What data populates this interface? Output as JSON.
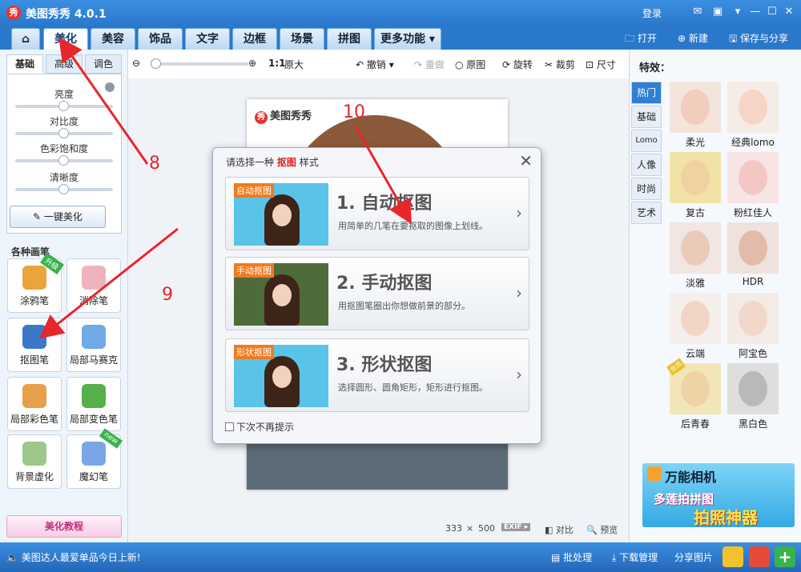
{
  "app": {
    "title": "美图秀秀 4.0.1",
    "logo_char": "秀",
    "login": "登录"
  },
  "menu": {
    "tabs": [
      "美化",
      "美容",
      "饰品",
      "文字",
      "边框",
      "场景",
      "拼图",
      "更多功能"
    ],
    "active": "美化",
    "right": {
      "open": "打开",
      "new": "新建",
      "save_share": "保存与分享"
    }
  },
  "left": {
    "subtabs": [
      "基础",
      "高级",
      "调色"
    ],
    "sliders": [
      "亮度",
      "对比度",
      "色彩饱和度",
      "清晰度"
    ],
    "one_key": "一键美化",
    "brush_title": "各种画笔",
    "tools": [
      {
        "label": "涂鸦笔",
        "badge": "升级"
      },
      {
        "label": "消除笔",
        "badge": ""
      },
      {
        "label": "抠图笔",
        "badge": ""
      },
      {
        "label": "局部马赛克",
        "badge": ""
      },
      {
        "label": "局部彩色笔",
        "badge": ""
      },
      {
        "label": "局部变色笔",
        "badge": ""
      },
      {
        "label": "背景虚化",
        "badge": ""
      },
      {
        "label": "魔幻笔",
        "badge": "new"
      }
    ],
    "tutorial": "美化教程"
  },
  "toolbar": {
    "ratio": "1:1",
    "original_size": "原大",
    "undo": "撤销",
    "redo": "重做",
    "original": "原图",
    "rotate": "旋转",
    "crop": "裁剪",
    "resize": "尺寸"
  },
  "canvas": {
    "watermark": "美图秀秀",
    "width": "333",
    "times": "×",
    "height": "500",
    "exif": "EXIF",
    "compare": "对比",
    "preview": "预览"
  },
  "dialog": {
    "title_prefix": "请选择一种",
    "title_keyword": "抠图",
    "title_suffix": "样式",
    "options": [
      {
        "tag": "自动抠图",
        "heading": "1. 自动抠图",
        "desc": "用简单的几笔在要抠取的图像上划线。"
      },
      {
        "tag": "手动抠图",
        "heading": "2. 手动抠图",
        "desc": "用抠图笔圈出你想做前景的部分。"
      },
      {
        "tag": "形状抠图",
        "heading": "3. 形状抠图",
        "desc": "选择圆形、圆角矩形，矩形进行抠图。"
      }
    ],
    "no_show": "下次不再提示"
  },
  "right": {
    "title": "特效：",
    "vtabs": [
      "热门",
      "基础",
      "Lomo",
      "人像",
      "时尚",
      "艺术"
    ],
    "active_vtab": "热门",
    "effects": [
      {
        "label": "柔光",
        "tone": "#f3e4dc",
        "face": "#f0cdbd"
      },
      {
        "label": "经典lomo",
        "tone": "#f6ece6",
        "face": "#f5d6c6"
      },
      {
        "label": "复古",
        "tone": "#f1e3a5",
        "face": "#f0d2a2"
      },
      {
        "label": "粉红佳人",
        "tone": "#f7e4e4",
        "face": "#f3c8c4"
      },
      {
        "label": "淡雅",
        "tone": "#f1e6e2",
        "face": "#eccab9"
      },
      {
        "label": "HDR",
        "tone": "#efe2dc",
        "face": "#e3bca9"
      },
      {
        "label": "云端",
        "tone": "#f6eeea",
        "face": "#f1d6c8"
      },
      {
        "label": "阿宝色",
        "tone": "#f4ebe6",
        "face": "#f2d8ca"
      },
      {
        "label": "后青春",
        "tone": "#f3e6b6",
        "face": "#efd2a6",
        "badge": "会员"
      },
      {
        "label": "黑白色",
        "tone": "#dedede",
        "face": "#b9b9b9"
      }
    ],
    "ad": {
      "title": "万能相机",
      "line1": "多莲拍拼图",
      "line2": "拍照神器"
    }
  },
  "status": {
    "marquee": "美图达人最爱单品今日上新!",
    "batch": "批处理",
    "download": "下载管理",
    "share": "分享图片"
  },
  "annotations": [
    "8",
    "9",
    "10"
  ],
  "colors": {
    "accent": "#2a78cc",
    "annotation": "#e8262b"
  }
}
